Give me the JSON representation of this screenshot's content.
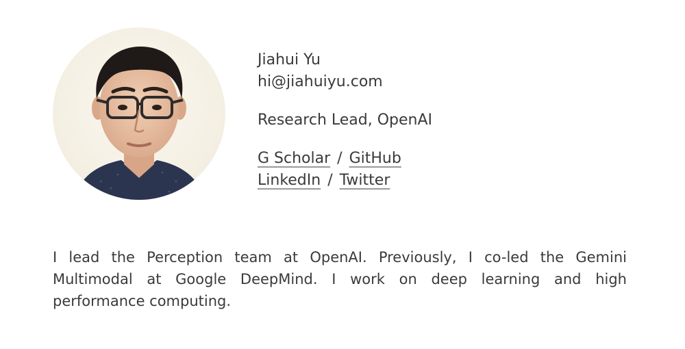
{
  "profile": {
    "name": "Jiahui Yu",
    "email": "hi@jiahuiyu.com",
    "role": "Research Lead, OpenAI",
    "links": {
      "scholar": "G Scholar",
      "github": "GitHub",
      "linkedin": "LinkedIn",
      "twitter": "Twitter",
      "separator": "/"
    }
  },
  "bio": "I lead the Perception team at OpenAI. Previously, I co-led the Gemini Multimodal at Google DeepMind. I work on deep learning and high performance computing.",
  "colors": {
    "text": "#3a3a3a",
    "underline": "#9a9a9a",
    "background": "#ffffff"
  }
}
